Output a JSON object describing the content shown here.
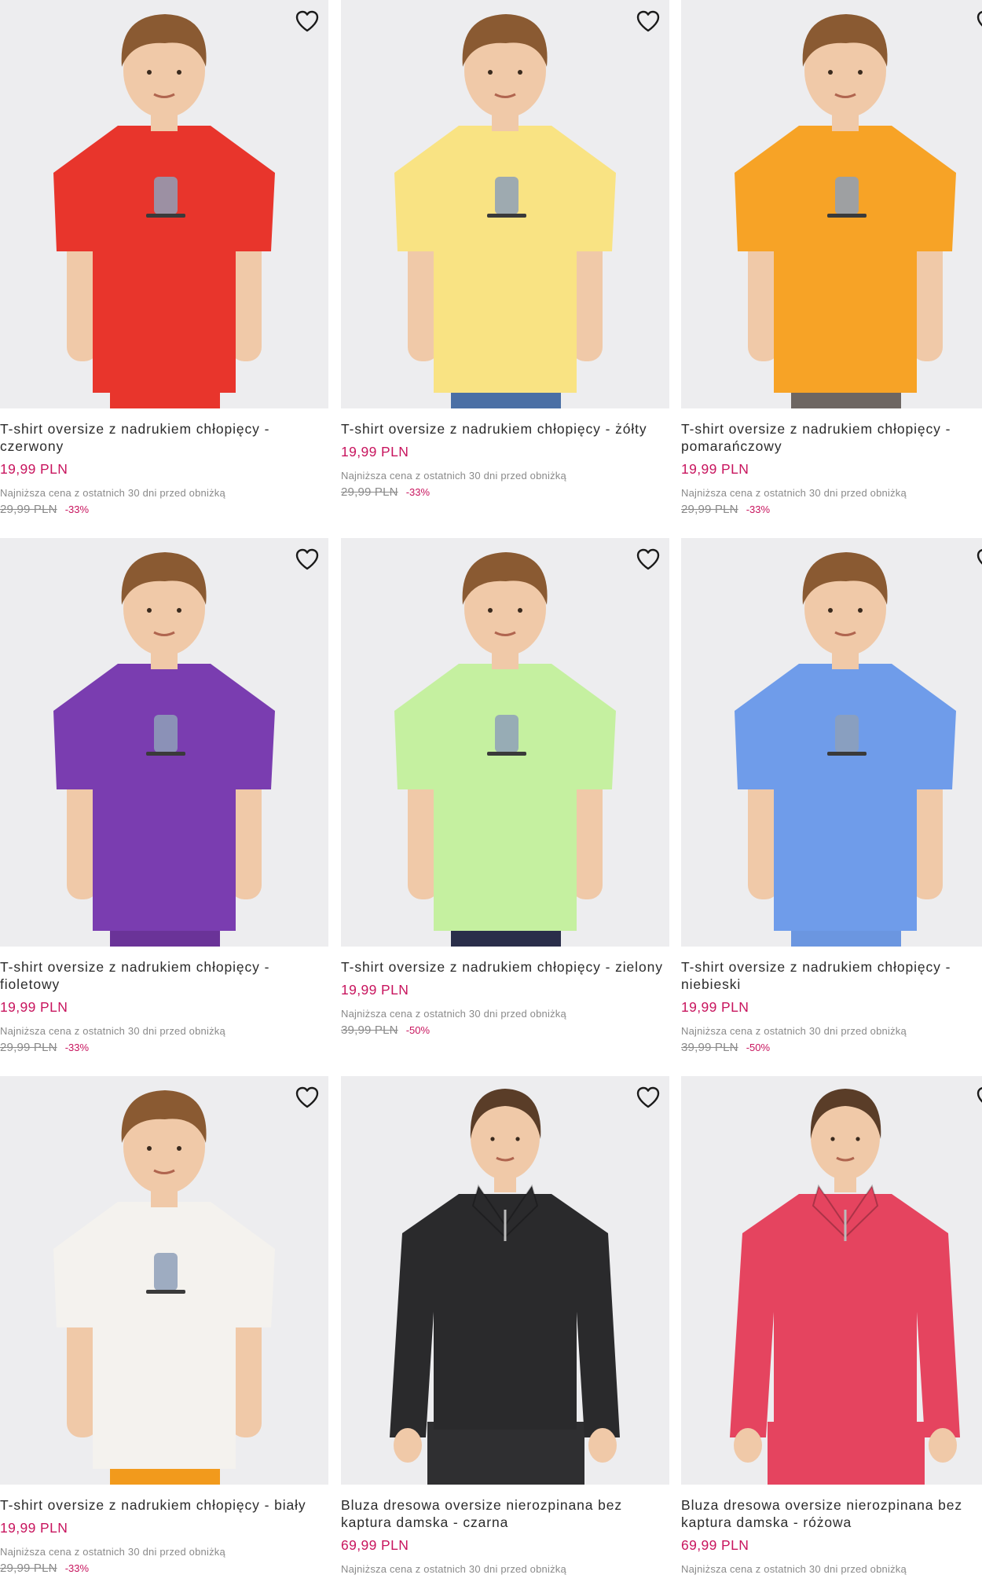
{
  "products": [
    {
      "title": "T-shirt oversize z nadrukiem chłopięcy - czerwony",
      "price": "19,99 PLN",
      "lowest_label": "Najniższa cena z ostatnich 30 dni przed obniżką",
      "old_price": "29,99 PLN",
      "discount": "-33%",
      "garment_color": "#e8352c",
      "bottom_color": "#e8352c",
      "model": "boy",
      "wishlist_icon": "heart-outline-icon"
    },
    {
      "title": "T-shirt oversize z nadrukiem chłopięcy - żółty",
      "price": "19,99 PLN",
      "lowest_label": "Najniższa cena z ostatnich 30 dni przed obniżką",
      "old_price": "29,99 PLN",
      "discount": "-33%",
      "garment_color": "#f9e383",
      "bottom_color": "#4a6fa5",
      "model": "boy",
      "wishlist_icon": "heart-outline-icon"
    },
    {
      "title": "T-shirt oversize z nadrukiem chłopięcy - pomarańczowy",
      "price": "19,99 PLN",
      "lowest_label": "Najniższa cena z ostatnich 30 dni przed obniżką",
      "old_price": "29,99 PLN",
      "discount": "-33%",
      "garment_color": "#f7a326",
      "bottom_color": "#6d6662",
      "model": "boy",
      "wishlist_icon": "heart-outline-icon"
    },
    {
      "title": "T-shirt oversize z nadrukiem chłopięcy - fioletowy",
      "price": "19,99 PLN",
      "lowest_label": "Najniższa cena z ostatnich 30 dni przed obniżką",
      "old_price": "29,99 PLN",
      "discount": "-33%",
      "garment_color": "#7a3db0",
      "bottom_color": "#6a3398",
      "model": "boy",
      "wishlist_icon": "heart-outline-icon"
    },
    {
      "title": "T-shirt oversize z nadrukiem chłopięcy - zielony",
      "price": "19,99 PLN",
      "lowest_label": "Najniższa cena z ostatnich 30 dni przed obniżką",
      "old_price": "39,99 PLN",
      "discount": "-50%",
      "garment_color": "#c5f0a0",
      "bottom_color": "#2a2e4a",
      "model": "boy",
      "wishlist_icon": "heart-outline-icon"
    },
    {
      "title": "T-shirt oversize z nadrukiem chłopięcy - niebieski",
      "price": "19,99 PLN",
      "lowest_label": "Najniższa cena z ostatnich 30 dni przed obniżką",
      "old_price": "39,99 PLN",
      "discount": "-50%",
      "garment_color": "#6f9cea",
      "bottom_color": "#6b96e0",
      "model": "boy",
      "wishlist_icon": "heart-outline-icon"
    },
    {
      "title": "T-shirt oversize z nadrukiem chłopięcy - biały",
      "price": "19,99 PLN",
      "lowest_label": "Najniższa cena z ostatnich 30 dni przed obniżką",
      "old_price": "29,99 PLN",
      "discount": "-33%",
      "garment_color": "#f4f2ee",
      "bottom_color": "#f29a1c",
      "model": "boy",
      "wishlist_icon": "heart-outline-icon"
    },
    {
      "title": "Bluza dresowa oversize nierozpinana bez kaptura damska - czarna",
      "price": "69,99 PLN",
      "lowest_label": "Najniższa cena z ostatnich 30 dni przed obniżką",
      "old_price": "",
      "discount": "",
      "garment_color": "#2a2a2c",
      "bottom_color": "#2f2f31",
      "model": "woman",
      "wishlist_icon": "heart-outline-icon"
    },
    {
      "title": "Bluza dresowa oversize nierozpinana bez kaptura damska - różowa",
      "price": "69,99 PLN",
      "lowest_label": "Najniższa cena z ostatnich 30 dni przed obniżką",
      "old_price": "",
      "discount": "",
      "garment_color": "#e5445f",
      "bottom_color": "#e5445f",
      "model": "woman",
      "wishlist_icon": "heart-outline-icon"
    }
  ]
}
